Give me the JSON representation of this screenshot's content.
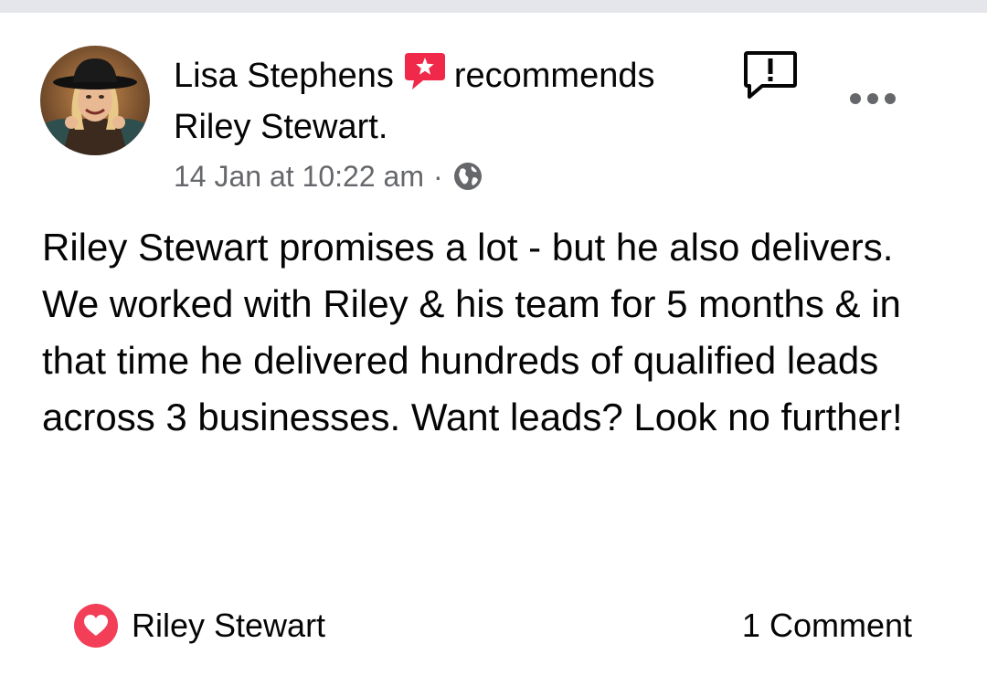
{
  "post": {
    "author": "Lisa Stephens",
    "action": "recommends",
    "subject": "Riley Stewart.",
    "timestamp": "14 Jan at 10:22 am",
    "separator": "·",
    "body": "Riley Stewart promises a lot - but he also delivers. We worked with Riley & his team for 5 months & in that time he delivered hundreds of qualified leads across 3 businesses. Want leads? Look no further!"
  },
  "footer": {
    "reaction_name": "Riley Stewart",
    "comments": "1 Comment"
  },
  "icons": {
    "recommend": "recommend-star-icon",
    "report": "report-icon",
    "more": "more-options-icon",
    "privacy": "globe-icon",
    "reaction": "heart-reaction-icon"
  },
  "colors": {
    "recommend_accent": "#f0284a",
    "heart_accent": "#f33e58",
    "meta_text": "#65676b",
    "top_bar": "#e4e6eb"
  }
}
